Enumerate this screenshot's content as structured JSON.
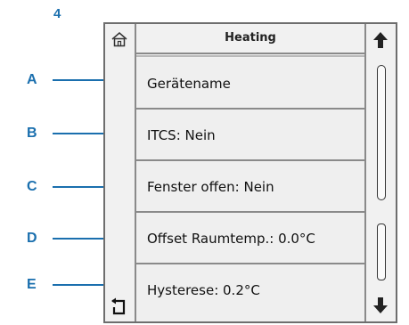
{
  "annotation_number": "4",
  "callouts": [
    "A",
    "B",
    "C",
    "D",
    "E"
  ],
  "screen": {
    "title": "Heating",
    "items": [
      {
        "label": "Gerätename"
      },
      {
        "label": "ITCS: Nein"
      },
      {
        "label": "Fenster offen: Nein"
      },
      {
        "label": "Offset Raumtemp.: 0.0°C"
      },
      {
        "label": "Hysterese: 0.2°C"
      }
    ],
    "icons": {
      "home": "home-icon",
      "back": "back-icon",
      "scroll_up": "arrow-up-icon",
      "scroll_down": "arrow-down-icon"
    }
  },
  "colors": {
    "annotation": "#1a6fae",
    "screen_bg": "#f1f1f1",
    "border": "#6e6e6e"
  }
}
